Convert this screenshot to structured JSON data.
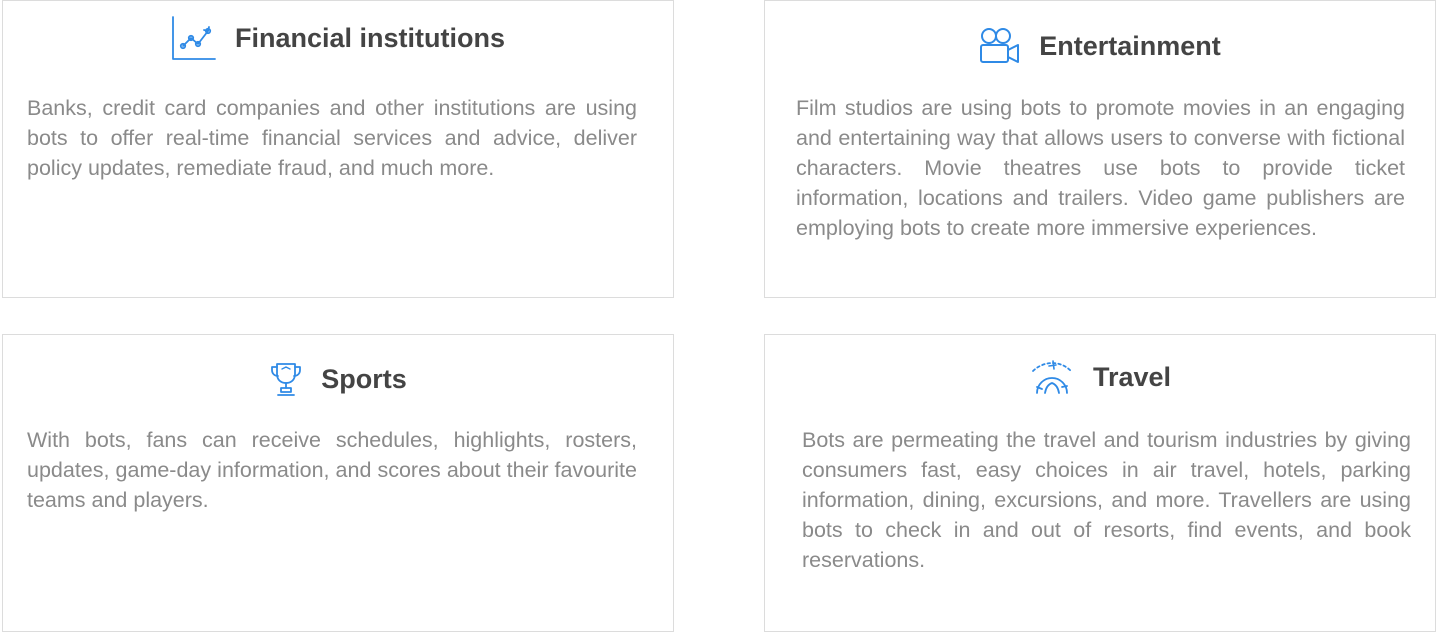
{
  "colors": {
    "icon_blue": "#2f8ae6",
    "title": "#444444",
    "text": "#8a8a8a",
    "border": "#dcdcdc"
  },
  "cards": [
    {
      "icon": "line-chart-icon",
      "title": "Financial institutions",
      "description": "Banks, credit card companies and other institutions are using bots to offer real-time financial services and advice, deliver policy updates, remediate fraud, and much more."
    },
    {
      "icon": "movie-camera-icon",
      "title": "Entertainment",
      "description": "Film studios are using bots to promote movies in an engaging and entertaining way that allows users to converse with fictional characters. Movie theatres use bots to provide ticket information, locations and trail­ers. Video game publishers are employing bots to create more immersive experiences."
    },
    {
      "icon": "trophy-icon",
      "title": "Sports",
      "description": "With bots, fans can receive schedules, highlights, ros­ters, updates, game-day information, and scores about their favourite teams and players."
    },
    {
      "icon": "plane-globe-icon",
      "title": "Travel",
      "description": "Bots are permeating the travel and tourism industries by giving consumers fast, easy choices in air travel, hotels, parking information, dining, excursions, and more. Travellers are using bots to check in and out of resorts, find events, and book reservations."
    }
  ]
}
